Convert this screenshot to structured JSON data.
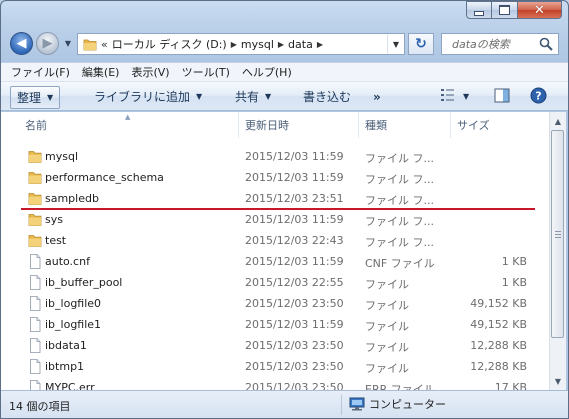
{
  "window": {
    "caption_buttons": {
      "minimize": "—",
      "maximize": "□",
      "close": "✕"
    }
  },
  "address": {
    "overflow": "«",
    "crumbs": [
      "ローカル ディスク (D:)",
      "mysql",
      "data"
    ],
    "icon": "folder-icon"
  },
  "search": {
    "placeholder": "dataの検索",
    "icon": "magnifier-icon"
  },
  "menu": [
    "ファイル(F)",
    "編集(E)",
    "表示(V)",
    "ツール(T)",
    "ヘルプ(H)"
  ],
  "toolbar": {
    "organize": "整理",
    "add_to_library": "ライブラリに追加",
    "share": "共有",
    "burn": "書き込む",
    "more": "»"
  },
  "columns": {
    "name": "名前",
    "date": "更新日時",
    "type": "種類",
    "size": "サイズ"
  },
  "files": [
    {
      "name": "mysql",
      "date": "2015/12/03 11:59",
      "type": "ファイル フ...",
      "size": "",
      "kind": "folder"
    },
    {
      "name": "performance_schema",
      "date": "2015/12/03 11:59",
      "type": "ファイル フ...",
      "size": "",
      "kind": "folder"
    },
    {
      "name": "sampledb",
      "date": "2015/12/03 23:51",
      "type": "ファイル フ...",
      "size": "",
      "kind": "folder"
    },
    {
      "name": "sys",
      "date": "2015/12/03 11:59",
      "type": "ファイル フ...",
      "size": "",
      "kind": "folder"
    },
    {
      "name": "test",
      "date": "2015/12/03 22:43",
      "type": "ファイル フ...",
      "size": "",
      "kind": "folder"
    },
    {
      "name": "auto.cnf",
      "date": "2015/12/03 11:59",
      "type": "CNF ファイル",
      "size": "1 KB",
      "kind": "file"
    },
    {
      "name": "ib_buffer_pool",
      "date": "2015/12/03 22:55",
      "type": "ファイル",
      "size": "1 KB",
      "kind": "file"
    },
    {
      "name": "ib_logfile0",
      "date": "2015/12/03 23:50",
      "type": "ファイル",
      "size": "49,152 KB",
      "kind": "file"
    },
    {
      "name": "ib_logfile1",
      "date": "2015/12/03 11:59",
      "type": "ファイル",
      "size": "49,152 KB",
      "kind": "file"
    },
    {
      "name": "ibdata1",
      "date": "2015/12/03 23:50",
      "type": "ファイル",
      "size": "12,288 KB",
      "kind": "file"
    },
    {
      "name": "ibtmp1",
      "date": "2015/12/03 23:50",
      "type": "ファイル",
      "size": "12,288 KB",
      "kind": "file"
    },
    {
      "name": "MYPC.err",
      "date": "2015/12/03 23:50",
      "type": "ERR ファイル",
      "size": "17 KB",
      "kind": "file"
    }
  ],
  "status": {
    "item_count": "14 個の項目",
    "location": "コンピューター"
  },
  "colors": {
    "highlight_line": "#c8172a",
    "folder": "#e8b84a",
    "accent": "#2c62b0"
  }
}
